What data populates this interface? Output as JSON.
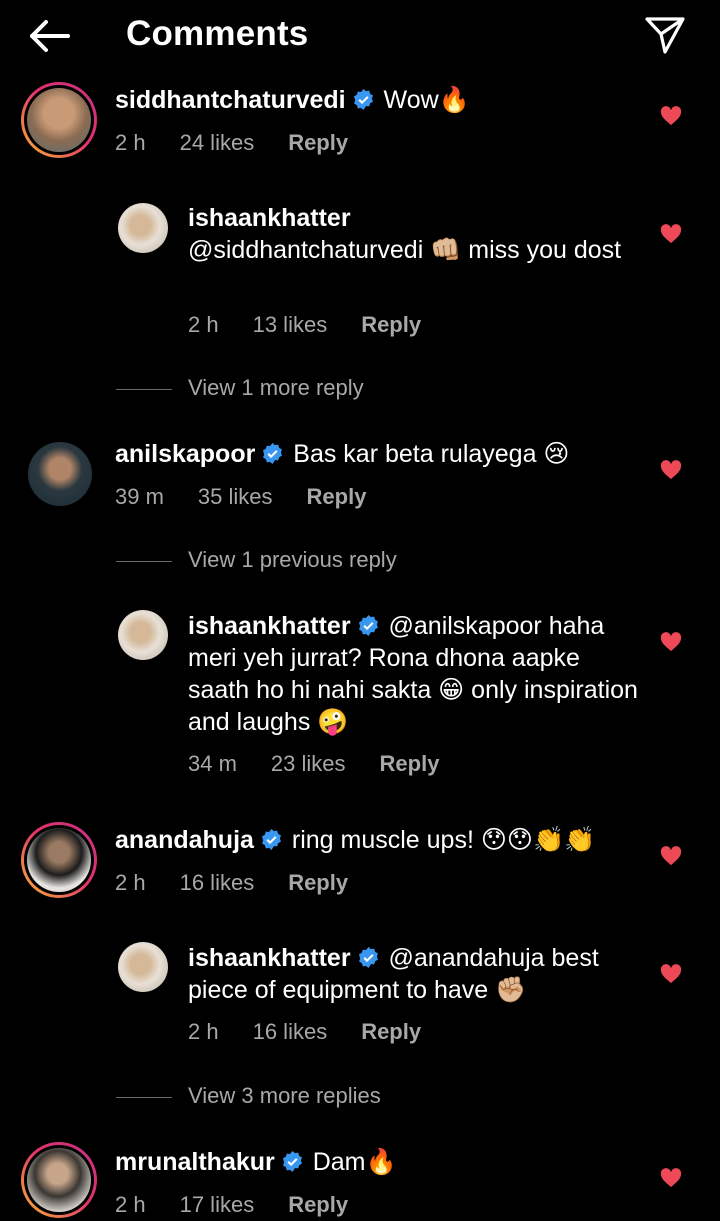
{
  "header": {
    "title": "Comments",
    "back_icon": "arrow-left-icon",
    "send_icon": "paper-plane-icon"
  },
  "colors": {
    "heart": "#ed4956",
    "verified": "#3897f0",
    "meta": "#a8a8a8"
  },
  "comments": [
    {
      "user": "siddhantchaturvedi",
      "verified": true,
      "text": "Wow🔥",
      "time": "2 h",
      "likes": "24 likes",
      "reply": "Reply"
    },
    {
      "user": "ishaankhatter",
      "verified": false,
      "text": "@siddhantchaturvedi 👊🏼 miss you dost",
      "time": "2 h",
      "likes": "13 likes",
      "reply": "Reply"
    },
    {
      "user": "anilskapoor",
      "verified": true,
      "text": "Bas kar beta rulayega 😢",
      "time": "39 m",
      "likes": "35 likes",
      "reply": "Reply"
    },
    {
      "user": "ishaankhatter",
      "verified": true,
      "text": "@anilskapoor haha meri yeh jurrat? Rona dhona aapke saath ho hi nahi sakta 😁 only inspiration and laughs 🤪",
      "time": "34 m",
      "likes": "23 likes",
      "reply": "Reply"
    },
    {
      "user": "anandahuja",
      "verified": true,
      "text": "ring muscle ups! 😯😯👏👏",
      "time": "2 h",
      "likes": "16 likes",
      "reply": "Reply"
    },
    {
      "user": "ishaankhatter",
      "verified": true,
      "text": "@anandahuja best piece of equipment to have ✊🏼",
      "time": "2 h",
      "likes": "16 likes",
      "reply": "Reply"
    },
    {
      "user": "mrunalthakur",
      "verified": true,
      "text": "Dam🔥",
      "time": "2 h",
      "likes": "17 likes",
      "reply": "Reply"
    }
  ],
  "view_more": [
    "View 1 more reply",
    "View 1 previous reply",
    "View 3 more replies"
  ]
}
